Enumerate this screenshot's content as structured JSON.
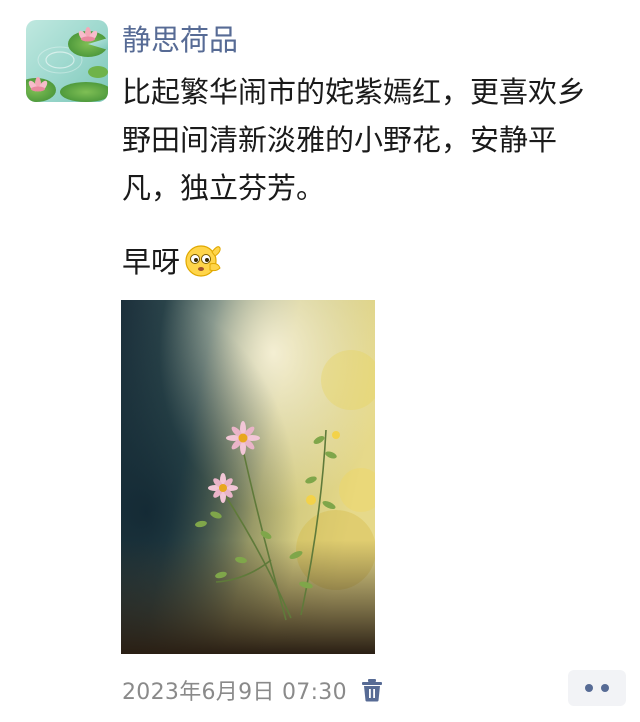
{
  "post": {
    "author": "静思荷品",
    "text_lines": [
      "比起繁华闹市的姹紫嫣红，更喜欢乡",
      "野田间清新淡雅的小野花，安静平",
      "凡，独立芬芳。"
    ],
    "greeting": "早呀",
    "greeting_emoji": "smirk-emoji",
    "avatar_icon": "lotus-pond-avatar",
    "photo_icon": "wildflower-photo",
    "timestamp": "2023年6月9日 07:30",
    "delete_icon": "trash-icon",
    "more_icon": "more-dots-icon"
  },
  "colors": {
    "author": "#576b95",
    "text": "#1a1a1a",
    "timestamp": "#8a8a8a",
    "more_bg": "#f2f3f6"
  }
}
